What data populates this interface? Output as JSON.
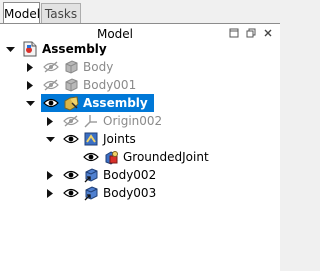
{
  "tabs": [
    {
      "label": "Model",
      "active": true
    },
    {
      "label": "Tasks",
      "active": false
    }
  ],
  "panel": {
    "title": "Model",
    "buttons": [
      "float-icon",
      "restore-icon",
      "close-icon"
    ]
  },
  "tree": {
    "root": {
      "label": "Assembly"
    },
    "items": [
      {
        "label": "Body"
      },
      {
        "label": "Body001"
      },
      {
        "label": "Assembly"
      },
      {
        "label": "Origin002"
      },
      {
        "label": "Joints"
      },
      {
        "label": "GroundedJoint"
      },
      {
        "label": "Body002"
      },
      {
        "label": "Body003"
      }
    ]
  },
  "colors": {
    "selection": "#0078d7",
    "hidden_text": "#8a8a8a"
  }
}
